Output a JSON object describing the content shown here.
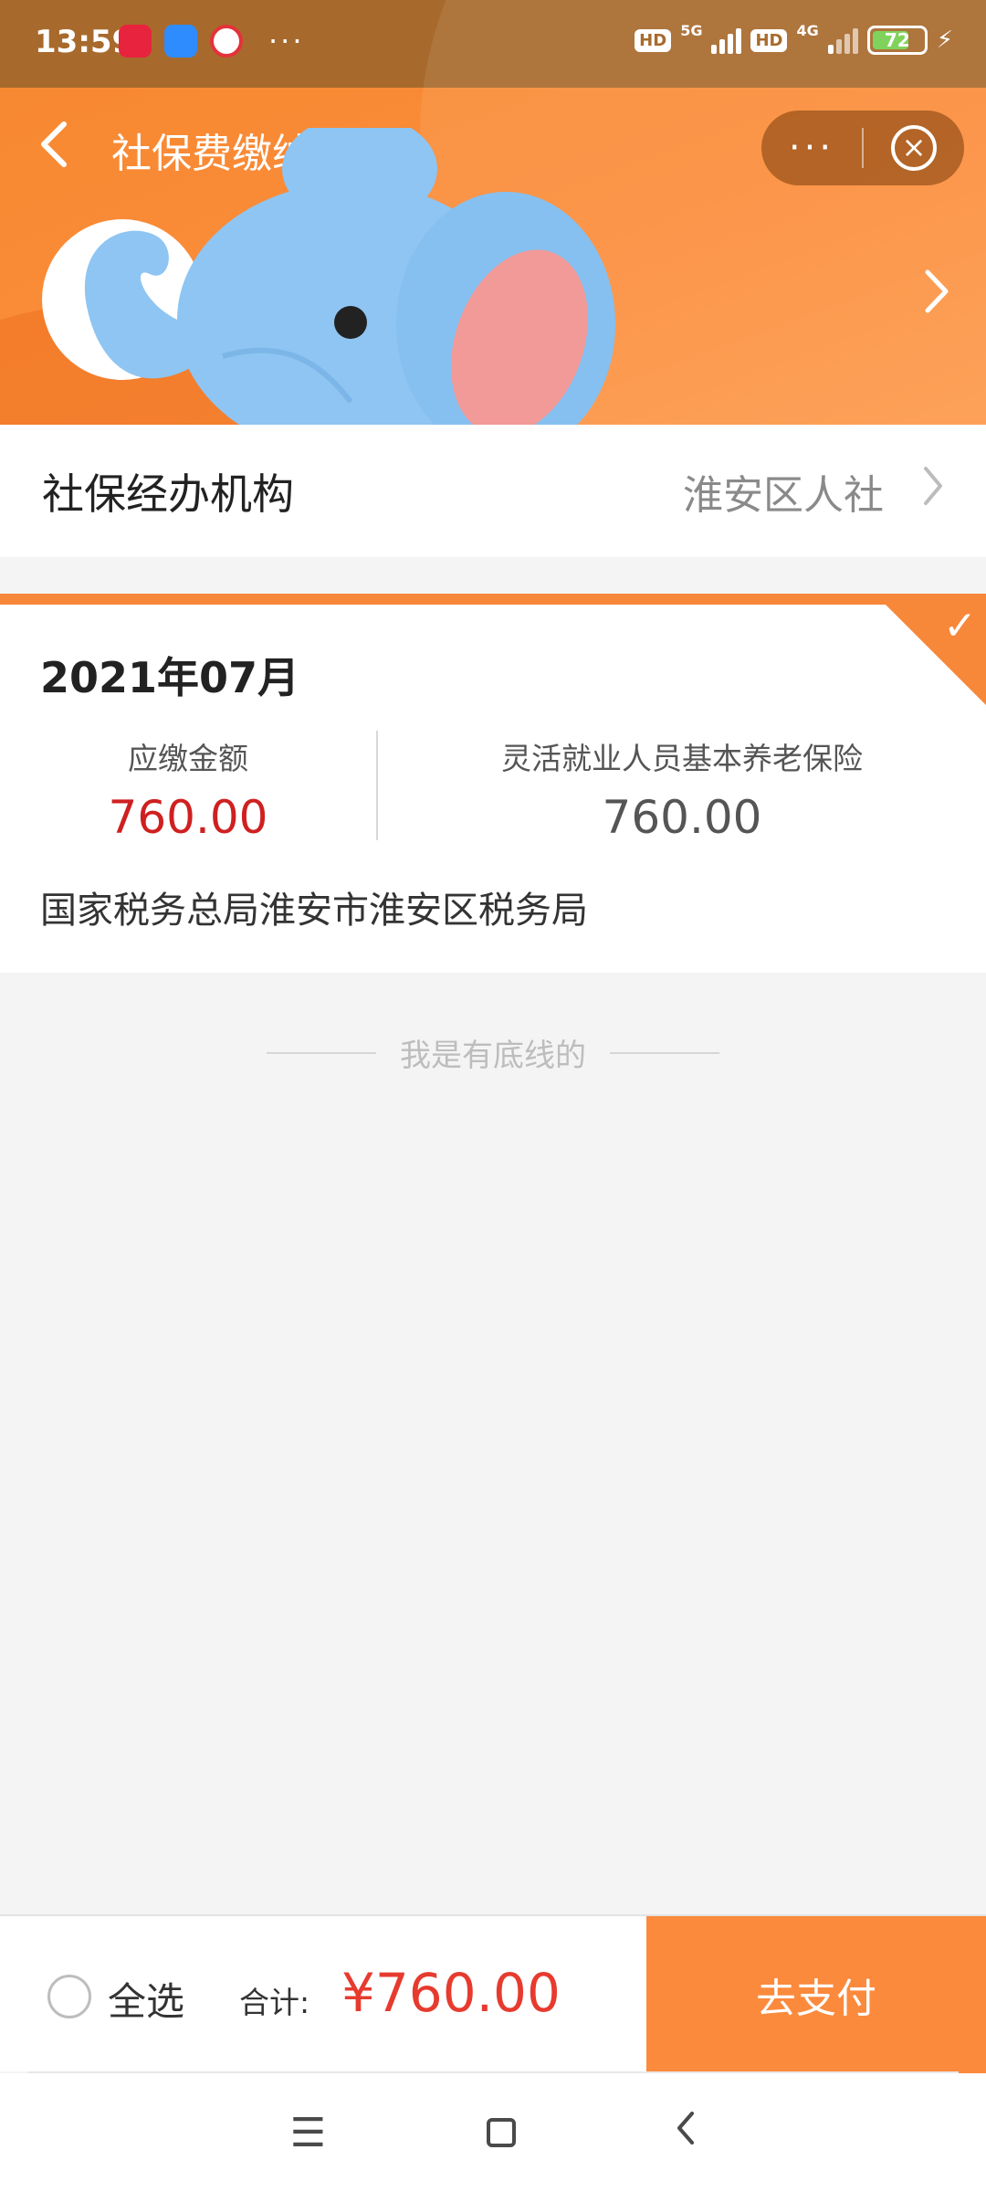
{
  "status_bar": {
    "time": "13:59",
    "more": "···",
    "hd1": "HD",
    "net1": "5G",
    "hd2": "HD",
    "net2": "4G",
    "battery": "72"
  },
  "nav": {
    "back_icon": "chevron-left-icon",
    "title": "社保费缴纳",
    "menu_icon": "···",
    "close_icon": "⊗"
  },
  "agency": {
    "label": "社保经办机构",
    "value": "淮安区人社"
  },
  "bill": {
    "period": "2021年07月",
    "due_label": "应缴金额",
    "due_amount": "760.00",
    "item_label": "灵活就业人员基本养老保险",
    "item_amount": "760.00",
    "bureau": "国家税务总局淮安市淮安区税务局",
    "selected": true
  },
  "list_end_text": "我是有底线的",
  "footer": {
    "select_all_label": "全选",
    "total_label": "合计:",
    "total_value": "¥760.00",
    "pay_button": "去支付"
  },
  "colors": {
    "accent_orange": "#fb8a3d",
    "amount_red": "#cf2020",
    "total_red": "#e63b2e"
  }
}
